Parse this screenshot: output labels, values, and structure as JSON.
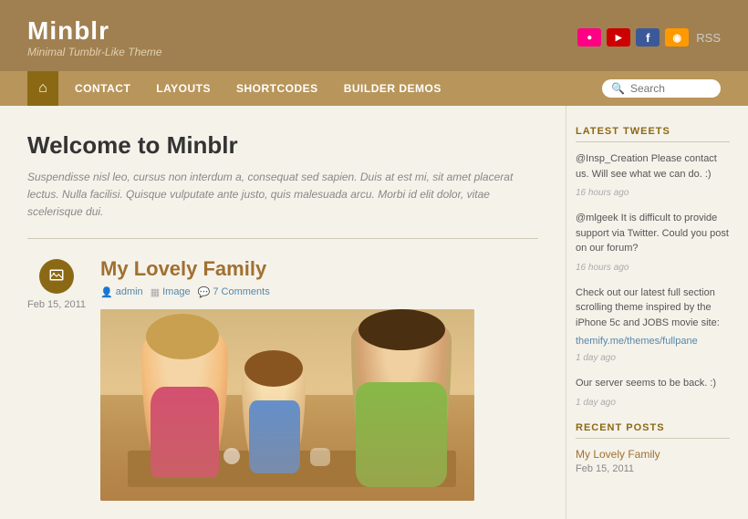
{
  "header": {
    "title": "Minblr",
    "subtitle": "Minimal Tumblr-Like Theme",
    "social": [
      {
        "name": "Flickr",
        "label": "f"
      },
      {
        "name": "YouTube",
        "label": "▶"
      },
      {
        "name": "Facebook",
        "label": "f"
      },
      {
        "name": "RSS",
        "label": "◉"
      },
      {
        "name": "RSS text",
        "label": "RSS"
      }
    ]
  },
  "nav": {
    "home_label": "⌂",
    "items": [
      {
        "label": "Contact"
      },
      {
        "label": "Layouts"
      },
      {
        "label": "Shortcodes"
      },
      {
        "label": "Builder Demos"
      }
    ],
    "search_placeholder": "Search"
  },
  "welcome": {
    "title": "Welcome to Minblr",
    "text": "Suspendisse nisl leo, cursus non interdum a, consequat sed sapien. Duis at est mi, sit amet placerat lectus. Nulla facilisi. Quisque vulputate ante justo, quis malesuada arcu. Morbi id elit dolor, vitae scelerisque dui."
  },
  "post": {
    "title": "My Lovely Family",
    "date": "Feb 15, 2011",
    "icon": "🖼",
    "meta": {
      "author": "admin",
      "category": "Image",
      "comments": "7 Comments"
    }
  },
  "sidebar": {
    "tweets_title": "Latest Tweets",
    "tweets": [
      {
        "text": "@Insp_Creation Please contact us. Will see what we can do. :)",
        "time": "16 hours ago"
      },
      {
        "text": "@mlgeek It is difficult to provide support via Twitter. Could you post on our forum?",
        "time": "16 hours ago"
      },
      {
        "text": "Check out our latest full section scrolling theme inspired by the iPhone 5c and JOBS movie site:",
        "link": "themify.me/themes/fullpane",
        "time": "1 day ago"
      },
      {
        "text": "Our server seems to be back. :)",
        "time": "1 day ago"
      }
    ],
    "recent_title": "Recent Posts",
    "recent_posts": [
      {
        "title": "My Lovely Family",
        "date": "Feb 15, 2011"
      }
    ]
  }
}
